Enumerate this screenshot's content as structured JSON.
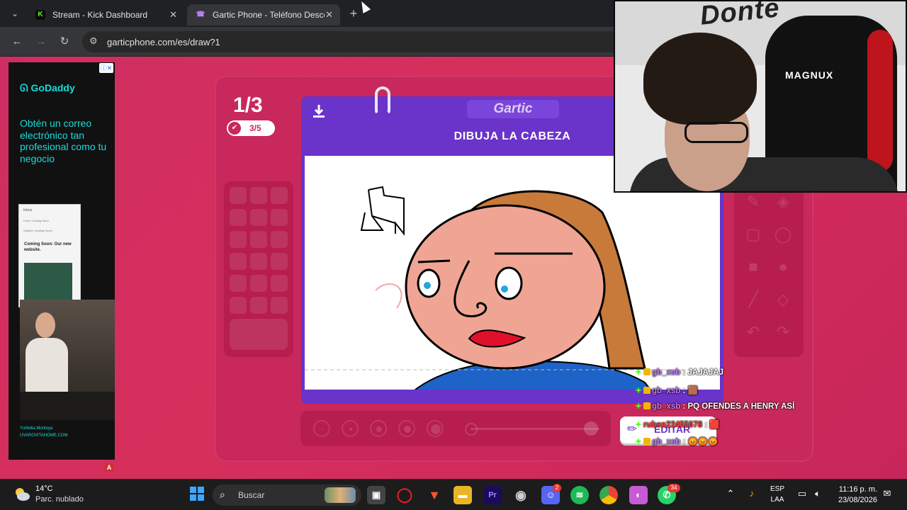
{
  "browser": {
    "tabs": [
      {
        "label": "Stream - Kick Dashboard",
        "icon": "kick-icon",
        "color": "#53fc18"
      },
      {
        "label": "Gartic Phone - Teléfono Descon",
        "icon": "gartic-phone-icon",
        "color": "#c57dff"
      }
    ],
    "tab_close": "✕",
    "new_tab": "+",
    "url": "garticphone.com/es/draw?1"
  },
  "ad": {
    "adchoice": "ⓘ✕",
    "brand": "GoDaddy",
    "headline": "Obtén un correo electrónico tan profesional como tu negocio",
    "mock_inbox": "Inbox",
    "mock_from": "From:   Coming Soon",
    "mock_subject": "Subject:   Coming Soon!",
    "mock_title": "Coming Soon: Our new website.",
    "signature_name": "Yuribdia Montoya",
    "signature_site": "UVAROVITAHOME.COM",
    "adblock_badge": "A"
  },
  "game": {
    "counter": "1/3",
    "score": "3/5",
    "logo": "Gartic",
    "instruction": "DIBUJA LA CABEZA",
    "download_icon": "download-icon",
    "edit_label": "EDITAR",
    "accent": "#6a33c9"
  },
  "chat": [
    {
      "user": "gb_xsb",
      "message": "JAJAJAJ"
    },
    {
      "user": "gb_xsb",
      "message": "🟫"
    },
    {
      "user": "gb_xsb",
      "message": "PQ OFENDES A HENRY ASÍ"
    },
    {
      "user": "ruben22455678",
      "message": "🟥"
    },
    {
      "user": "gb_xsb",
      "message": "😡😡😡"
    }
  ],
  "webcam": {
    "wall_text": "Donte",
    "chair_label": "MAGNUX"
  },
  "taskbar": {
    "temperature": "14°C",
    "weather": "Parc. nublado",
    "search_placeholder": "Buscar",
    "language": "ESP",
    "layout": "LAA",
    "time": "11:16 p. m.",
    "date": "23/08/2026",
    "notify_count": "34",
    "discord_badge": "2"
  }
}
